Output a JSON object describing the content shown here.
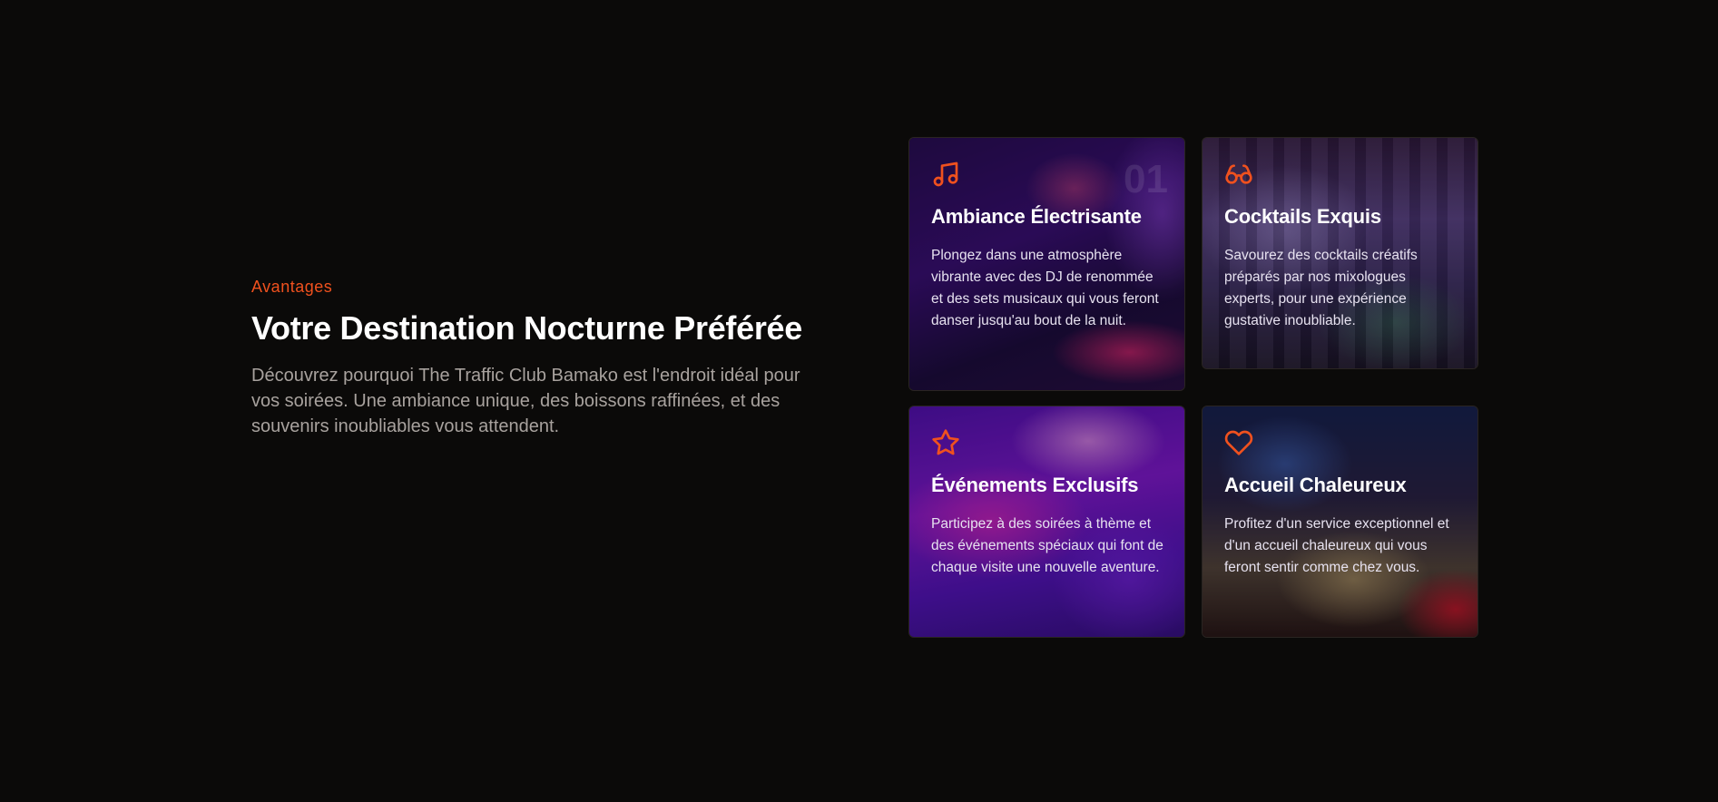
{
  "intro": {
    "eyebrow": "Avantages",
    "title": "Votre Destination Nocturne Préférée",
    "description": "Découvrez pourquoi The Traffic Club Bamako est l'endroit idéal pour vos soirées. Une ambiance unique, des boissons raffinées, et des souvenirs inoubliables vous attendent."
  },
  "cards": [
    {
      "icon": "music-note-icon",
      "number": "01",
      "title": "Ambiance Électrisante",
      "text": "Plongez dans une atmosphère vibrante avec des DJ de renommée et des sets musicaux qui vous feront danser jusqu'au bout de la nuit."
    },
    {
      "icon": "glasses-icon",
      "title": "Cocktails Exquis",
      "text": "Savourez des cocktails créatifs préparés par nos mixologues experts, pour une expérience gustative inoubliable."
    },
    {
      "icon": "star-icon",
      "title": "Événements Exclusifs",
      "text": "Participez à des soirées à thème et des événements spéciaux qui font de chaque visite une nouvelle aventure."
    },
    {
      "icon": "heart-icon",
      "title": "Accueil Chaleureux",
      "text": "Profitez d'un service exceptionnel et d'un accueil chaleureux qui vous feront sentir comme chez vous."
    }
  ],
  "colors": {
    "accent": "#f0511e",
    "background": "#0b0a09"
  }
}
